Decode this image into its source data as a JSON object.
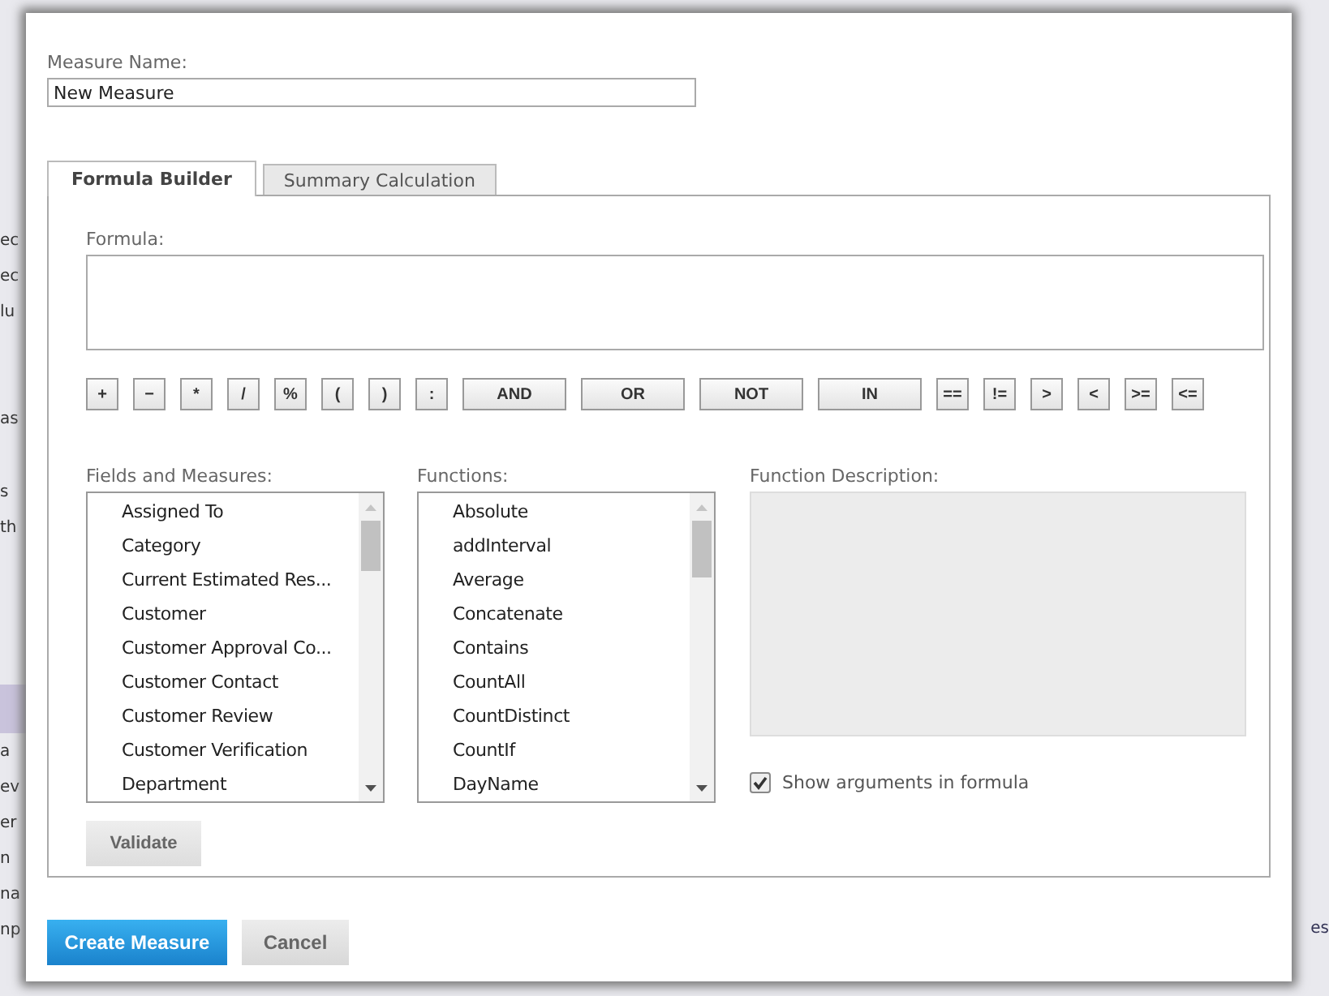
{
  "background_fragments": [
    "ec",
    "ec",
    "lu",
    "as",
    "s",
    "th",
    "a",
    "ev",
    "er",
    "n",
    "na",
    "np"
  ],
  "background_fragment_right": "es",
  "dialog": {
    "name_label": "Measure Name:",
    "name_value": "New Measure",
    "tabs": [
      {
        "label": "Formula Builder",
        "selected": true
      },
      {
        "label": "Summary Calculation",
        "selected": false
      }
    ],
    "formula_label": "Formula:",
    "operators": [
      "+",
      "−",
      "*",
      "/",
      "%",
      "(",
      ")",
      ":",
      "AND",
      "OR",
      "NOT",
      "IN",
      "==",
      "!=",
      ">",
      "<",
      ">=",
      "<="
    ],
    "fields_label": "Fields and Measures:",
    "fields": [
      "Assigned To",
      "Category",
      "Current Estimated Res...",
      "Customer",
      "Customer Approval Co...",
      "Customer Contact",
      "Customer Review",
      "Customer Verification",
      "Department"
    ],
    "functions_label": "Functions:",
    "functions": [
      "Absolute",
      "addInterval",
      "Average",
      "Concatenate",
      "Contains",
      "CountAll",
      "CountDistinct",
      "CountIf",
      "DayName"
    ],
    "description_label": "Function Description:",
    "show_arguments": {
      "label": "Show arguments in formula",
      "checked": true
    },
    "validate_button": "Validate",
    "buttons": [
      {
        "label": "Create Measure",
        "kind": "primary"
      },
      {
        "label": "Cancel",
        "kind": "secondary"
      }
    ]
  }
}
